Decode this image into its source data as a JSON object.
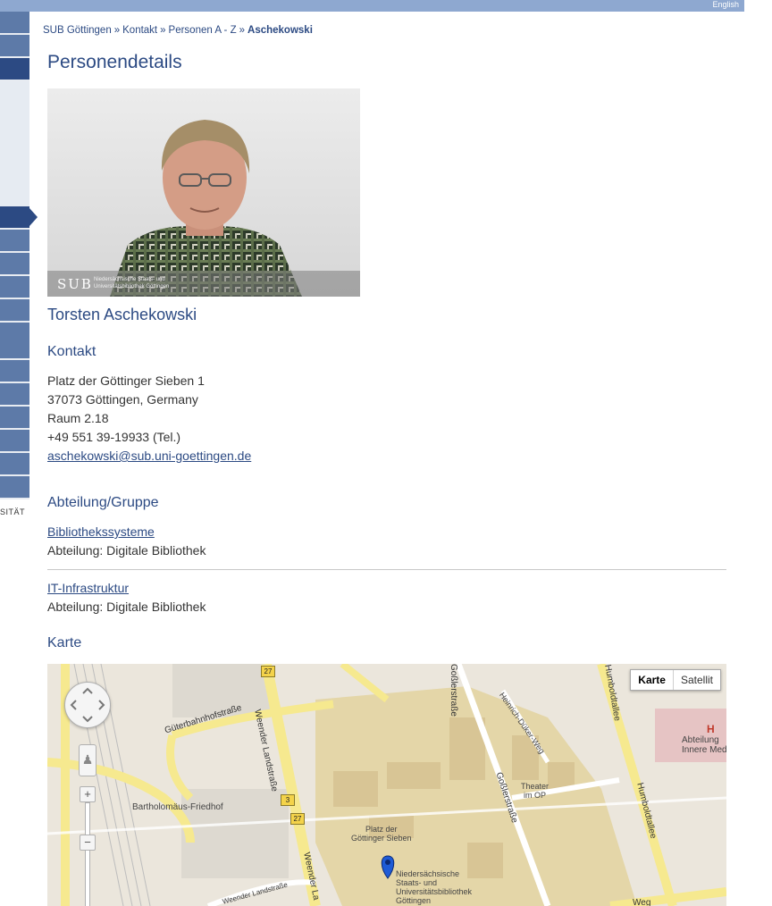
{
  "topbar": {
    "language_link": "English"
  },
  "sidebar": {
    "footer_text": "SITÄT"
  },
  "breadcrumb": {
    "items": [
      "SUB Göttingen",
      "Kontakt",
      "Personen A - Z"
    ],
    "separator": "»",
    "current": "Aschekowski"
  },
  "page": {
    "title": "Personendetails"
  },
  "photo": {
    "logo_text": "SUB",
    "logo_subtext_1": "Niedersächsische Staats- und",
    "logo_subtext_2": "Universitätsbibliothek Göttingen"
  },
  "person": {
    "name": "Torsten Aschekowski"
  },
  "contact": {
    "heading": "Kontakt",
    "address_line1": "Platz der Göttinger Sieben 1",
    "address_line2": "37073 Göttingen, Germany",
    "room": "Raum 2.18",
    "phone": "+49 551 39-19933 (Tel.)",
    "email": "aschekowski@sub.uni-goettingen.de"
  },
  "department": {
    "heading": "Abteilung/Gruppe",
    "groups": [
      {
        "name": "Bibliothekssysteme",
        "detail": "Abteilung: Digitale Bibliothek"
      },
      {
        "name": "IT-Infrastruktur",
        "detail": "Abteilung: Digitale Bibliothek"
      }
    ]
  },
  "map": {
    "heading": "Karte",
    "type_buttons": [
      "Karte",
      "Satellit"
    ],
    "active_type": "Karte",
    "zoom_in": "+",
    "zoom_out": "−",
    "labels": {
      "gueterbahnhof": "Güterbahnhofstraße",
      "weender1": "Weender Landstraße",
      "weender2": "Weender Landstraße",
      "weender3": "Weender La",
      "gosslerstrasse1": "Goßlerstraße",
      "gosslerstrasse2": "Goßlerstraße",
      "humboldtallee1": "Humboldtallee",
      "humboldtallee2": "Humboldtallee",
      "heinrich": "Heinrich-Düker-Weg",
      "bartholomaeus": "Bartholomäus-Friedhof",
      "theater": "Theater",
      "theater2": "im OP",
      "platz1": "Platz der",
      "platz2": "Göttinger Sieben",
      "sub1": "Niedersächsische",
      "sub2": "Staats- und",
      "sub3": "Universitätsbibliothek",
      "sub4": "Göttingen",
      "hospital_h": "H",
      "abteilung1": "Abteilung",
      "abteilung2": "Innere Med",
      "weg": "Weg",
      "shield27a": "27",
      "shield27b": "27",
      "shield3": "3"
    }
  }
}
